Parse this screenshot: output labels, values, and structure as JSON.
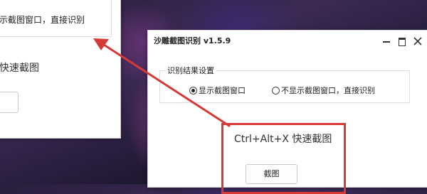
{
  "background_window": {
    "radio_option_text": "示截图窗口，直接识别",
    "shortcut_text": "快速截图"
  },
  "app": {
    "title": "沙雕截图识别  v1.5.9",
    "group_title": "识别结果设置",
    "radio_options": [
      {
        "label": "显示截图窗口",
        "checked": true
      },
      {
        "label": "不显示截图窗口，直接识别",
        "checked": false
      }
    ],
    "shortcut_text": "Ctrl+Alt+X 快速截图",
    "capture_button_label": "截图"
  },
  "annotation_color": "#d63a36",
  "icons": [
    "minimize-icon",
    "maximize-icon",
    "close-icon"
  ]
}
